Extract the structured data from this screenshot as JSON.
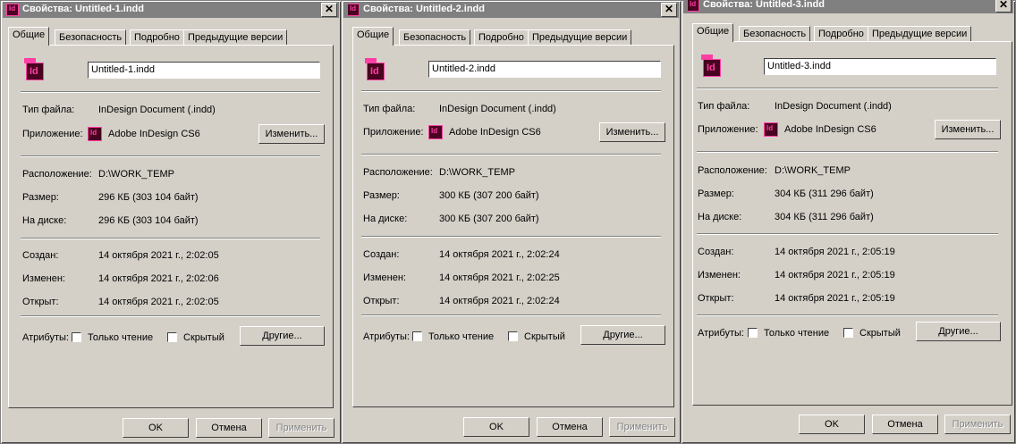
{
  "windows": [
    {
      "title": "Свойства: Untitled-1.indd",
      "close": "✕",
      "tabs": [
        "Общие",
        "Безопасность",
        "Подробно",
        "Предыдущие версии"
      ],
      "file_name": "Untitled-1.indd",
      "icon_label": "Id",
      "labels": {
        "type": "Тип файла:",
        "app": "Приложение:",
        "location": "Расположение:",
        "size": "Размер:",
        "ondisk": "На диске:",
        "created": "Создан:",
        "modified": "Изменен:",
        "opened": "Открыт:",
        "attrs": "Атрибуты:"
      },
      "file_type": "InDesign Document (.indd)",
      "app_name": "Adobe InDesign CS6",
      "change_button": "Изменить...",
      "location": "D:\\WORK_TEMP",
      "size": "296 КБ (303 104 байт)",
      "ondisk": "296 КБ (303 104 байт)",
      "created": "14 октября 2021 г., 2:02:05",
      "modified": "14 октября 2021 г., 2:02:06",
      "opened": "14 октября 2021 г., 2:02:05",
      "readonly_label": "Только чтение",
      "hidden_label": "Скрытый",
      "other_button": "Другие...",
      "ok": "OK",
      "cancel": "Отмена",
      "apply": "Применить"
    },
    {
      "title": "Свойства: Untitled-2.indd",
      "close": "✕",
      "tabs": [
        "Общие",
        "Безопасность",
        "Подробно",
        "Предыдущие версии"
      ],
      "file_name": "Untitled-2.indd",
      "icon_label": "Id",
      "labels": {
        "type": "Тип файла:",
        "app": "Приложение:",
        "location": "Расположение:",
        "size": "Размер:",
        "ondisk": "На диске:",
        "created": "Создан:",
        "modified": "Изменен:",
        "opened": "Открыт:",
        "attrs": "Атрибуты:"
      },
      "file_type": "InDesign Document (.indd)",
      "app_name": "Adobe InDesign CS6",
      "change_button": "Изменить...",
      "location": "D:\\WORK_TEMP",
      "size": "300 КБ (307 200 байт)",
      "ondisk": "300 КБ (307 200 байт)",
      "created": "14 октября 2021 г., 2:02:24",
      "modified": "14 октября 2021 г., 2:02:25",
      "opened": "14 октября 2021 г., 2:02:24",
      "readonly_label": "Только чтение",
      "hidden_label": "Скрытый",
      "other_button": "Другие...",
      "ok": "OK",
      "cancel": "Отмена",
      "apply": "Применить"
    },
    {
      "title": "Свойства: Untitled-3.indd",
      "close": "✕",
      "tabs": [
        "Общие",
        "Безопасность",
        "Подробно",
        "Предыдущие версии"
      ],
      "file_name": "Untitled-3.indd",
      "icon_label": "Id",
      "labels": {
        "type": "Тип файла:",
        "app": "Приложение:",
        "location": "Расположение:",
        "size": "Размер:",
        "ondisk": "На диске:",
        "created": "Создан:",
        "modified": "Изменен:",
        "opened": "Открыт:",
        "attrs": "Атрибуты:"
      },
      "file_type": "InDesign Document (.indd)",
      "app_name": "Adobe InDesign CS6",
      "change_button": "Изменить...",
      "location": "D:\\WORK_TEMP",
      "size": "304 КБ (311 296 байт)",
      "ondisk": "304 КБ (311 296 байт)",
      "created": "14 октября 2021 г., 2:05:19",
      "modified": "14 октября 2021 г., 2:05:19",
      "opened": "14 октября 2021 г., 2:05:19",
      "readonly_label": "Только чтение",
      "hidden_label": "Скрытый",
      "other_button": "Другие...",
      "ok": "OK",
      "cancel": "Отмена",
      "apply": "Применить"
    }
  ]
}
